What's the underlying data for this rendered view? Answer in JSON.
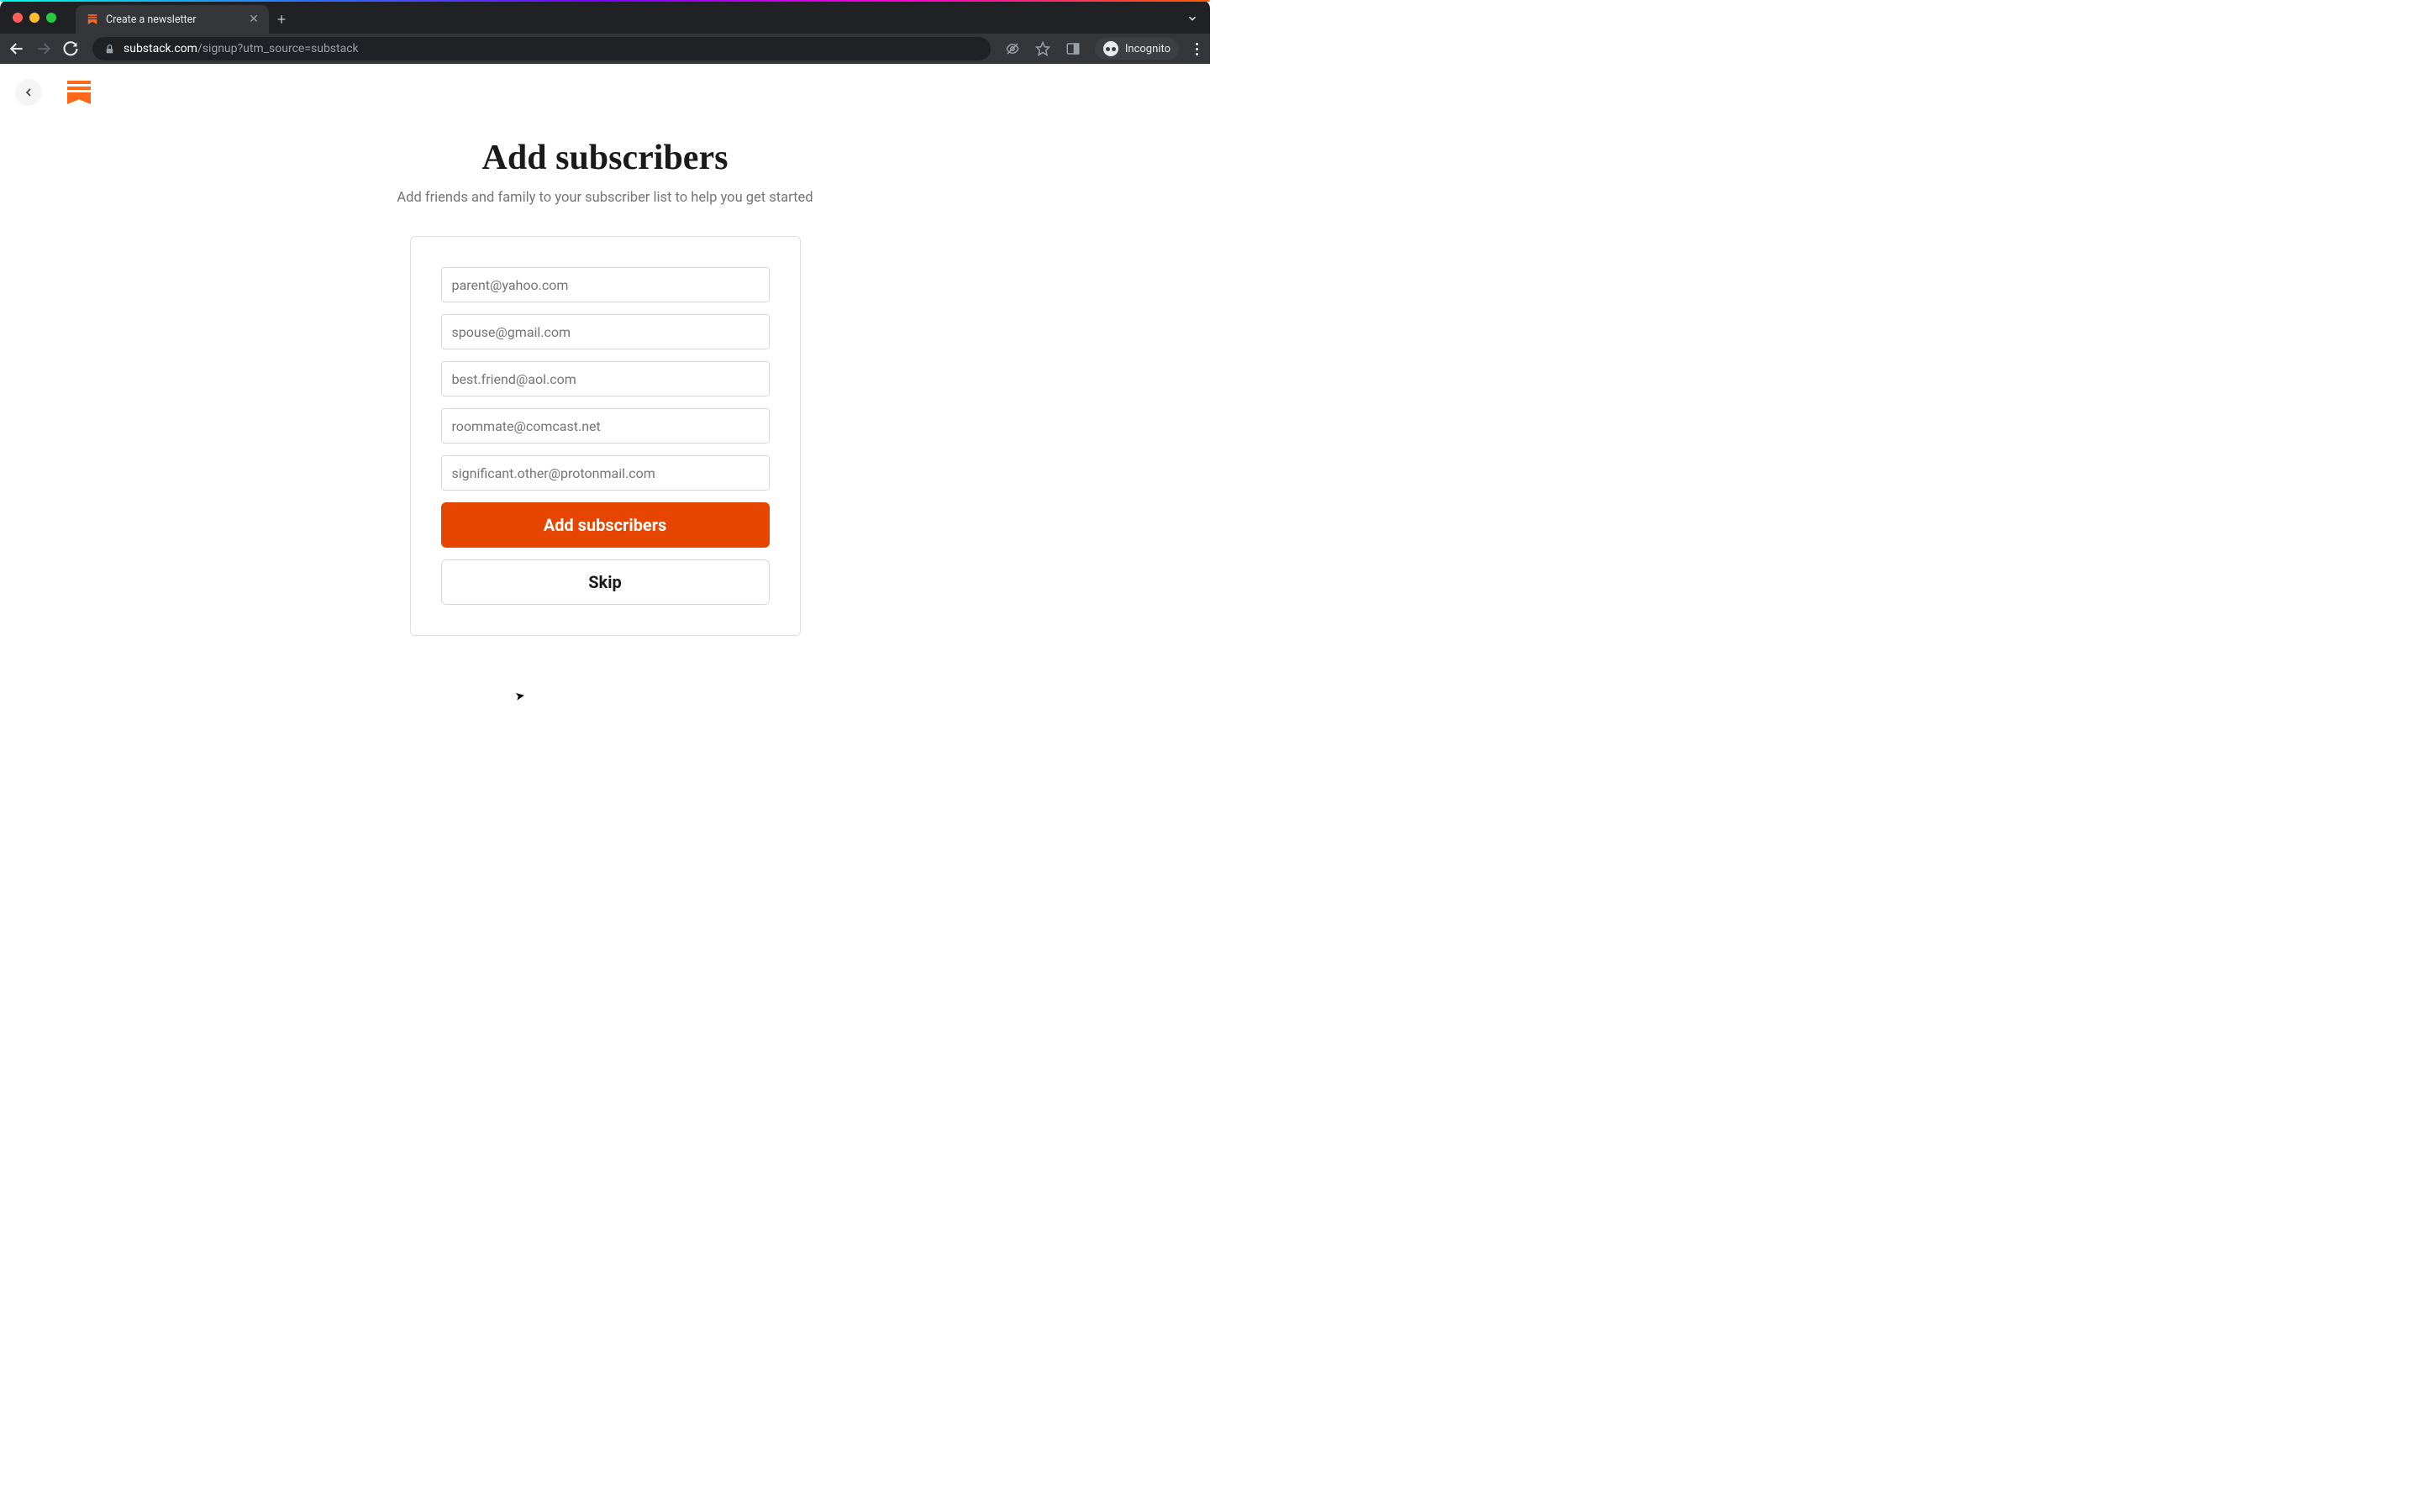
{
  "browser": {
    "tab_title": "Create a newsletter",
    "url_domain": "substack.com",
    "url_path": "/signup?utm_source=substack",
    "incognito_label": "Incognito"
  },
  "page": {
    "title": "Add subscribers",
    "subtitle": "Add friends and family to your subscriber list to help you get started",
    "email_placeholders": [
      "parent@yahoo.com",
      "spouse@gmail.com",
      "best.friend@aol.com",
      "roommate@comcast.net",
      "significant.other@protonmail.com"
    ],
    "primary_button_label": "Add subscribers",
    "secondary_button_label": "Skip"
  },
  "colors": {
    "brand": "#ff6719",
    "primary_button": "#e64500"
  }
}
